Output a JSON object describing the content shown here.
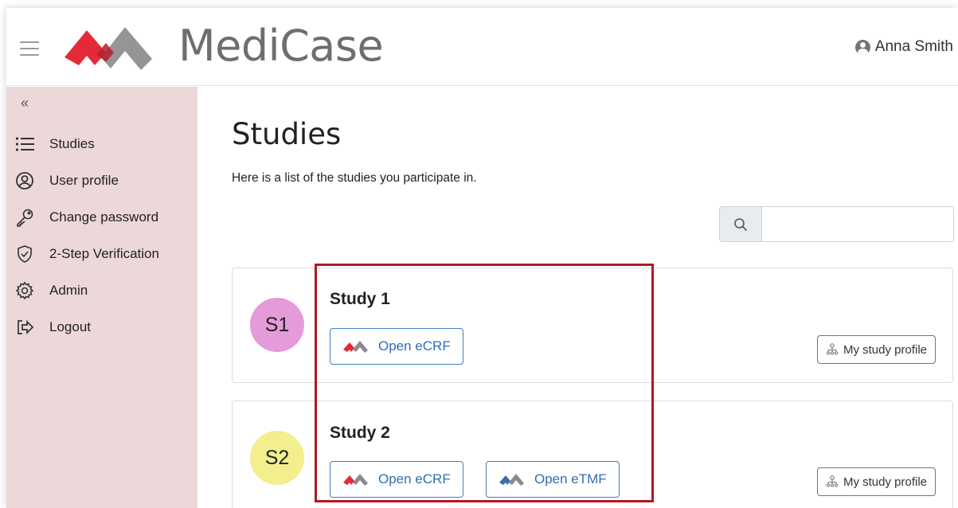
{
  "app": {
    "name": "MediCase",
    "user_name": "Anna Smith"
  },
  "colors": {
    "brand_red": "#e42a37",
    "brand_gray": "#8a8a8a",
    "brand_blue": "#3d6fb0",
    "sidebar_bg": "#ecd8d9",
    "avatar_s1": "#e59ad9",
    "avatar_s2": "#f3ee8e",
    "highlight": "#b3181f"
  },
  "sidebar": {
    "collapse_label": "«",
    "items": [
      {
        "label": "Studies",
        "icon": "list-icon"
      },
      {
        "label": "User profile",
        "icon": "user-circle-icon"
      },
      {
        "label": "Change password",
        "icon": "key-icon"
      },
      {
        "label": "2-Step Verification",
        "icon": "shield-check-icon"
      },
      {
        "label": "Admin",
        "icon": "gear-icon"
      },
      {
        "label": "Logout",
        "icon": "logout-icon"
      }
    ]
  },
  "main": {
    "title": "Studies",
    "subtitle": "Here is a list of the studies you participate in.",
    "search": {
      "value": "",
      "placeholder": ""
    }
  },
  "studies": [
    {
      "avatar": "S1",
      "name": "Study 1",
      "buttons": [
        {
          "label": "Open eCRF",
          "icon": "medicase-red-logo-icon"
        }
      ],
      "profile_label": "My study profile"
    },
    {
      "avatar": "S2",
      "name": "Study 2",
      "buttons": [
        {
          "label": "Open eCRF",
          "icon": "medicase-red-logo-icon"
        },
        {
          "label": "Open eTMF",
          "icon": "medicase-blue-logo-icon"
        }
      ],
      "profile_label": "My study profile"
    }
  ]
}
